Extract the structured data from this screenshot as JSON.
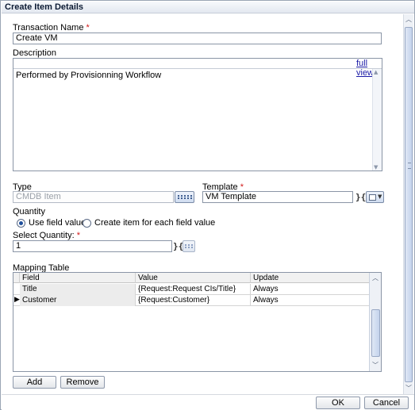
{
  "dialog": {
    "title": "Create Item Details"
  },
  "form": {
    "transaction_name": {
      "label": "Transaction Name",
      "required": "*",
      "value": "Create VM"
    },
    "description": {
      "label": "Description",
      "full_view": "full view",
      "value": "Performed by Provisionning Workflow"
    },
    "type": {
      "label": "Type",
      "value": "CMDB Item"
    },
    "template": {
      "label": "Template",
      "required": "*",
      "value": "VM Template"
    },
    "quantity": {
      "label": "Quantity",
      "option_use": "Use field value",
      "option_create": "Create item for each field value",
      "selected": "Use field value"
    },
    "select_quantity": {
      "label": "Select Quantity:",
      "required": "*",
      "value": "1"
    }
  },
  "mapping_table": {
    "label": "Mapping Table",
    "columns": [
      "Field",
      "Value",
      "Update"
    ],
    "rows": [
      {
        "field": "Title",
        "value": "{Request:Request CIs/Title}",
        "update": "Always"
      },
      {
        "field": "Customer",
        "value": "{Request:Customer}",
        "update": "Always"
      }
    ],
    "add_label": "Add",
    "remove_label": "Remove"
  },
  "footer": {
    "ok_label": "OK",
    "cancel_label": "Cancel"
  },
  "icons": {
    "expression": "expression-icon",
    "list": "list-icon",
    "dropdown": "chevron-down-icon",
    "row_pointer": "row-pointer-icon"
  }
}
